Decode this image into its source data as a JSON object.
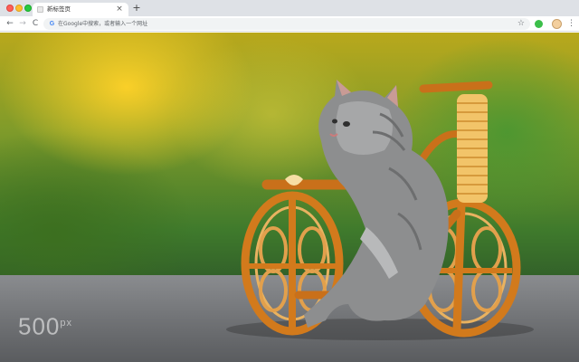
{
  "window": {
    "traffic_lights": [
      "close",
      "minimize",
      "zoom"
    ]
  },
  "tab": {
    "title": "新标签页",
    "close_glyph": "×",
    "favicon": "page-icon"
  },
  "new_tab_glyph": "+",
  "toolbar": {
    "back_glyph": "←",
    "forward_glyph": "→",
    "reload_glyph": "C",
    "omnibox": {
      "search_engine_glyph": "G",
      "placeholder": "在Google中搜索，或者输入一个网址"
    },
    "star_glyph": "☆",
    "menu_glyph": "⋮"
  },
  "wallpaper": {
    "subject": "kitten on a wicker bicycle",
    "watermark_main": "500",
    "watermark_sup": "px"
  },
  "colors": {
    "chrome_bg": "#dee1e6",
    "omnibox_bg": "#f1f3f4",
    "extension": "#3cbf4a"
  }
}
